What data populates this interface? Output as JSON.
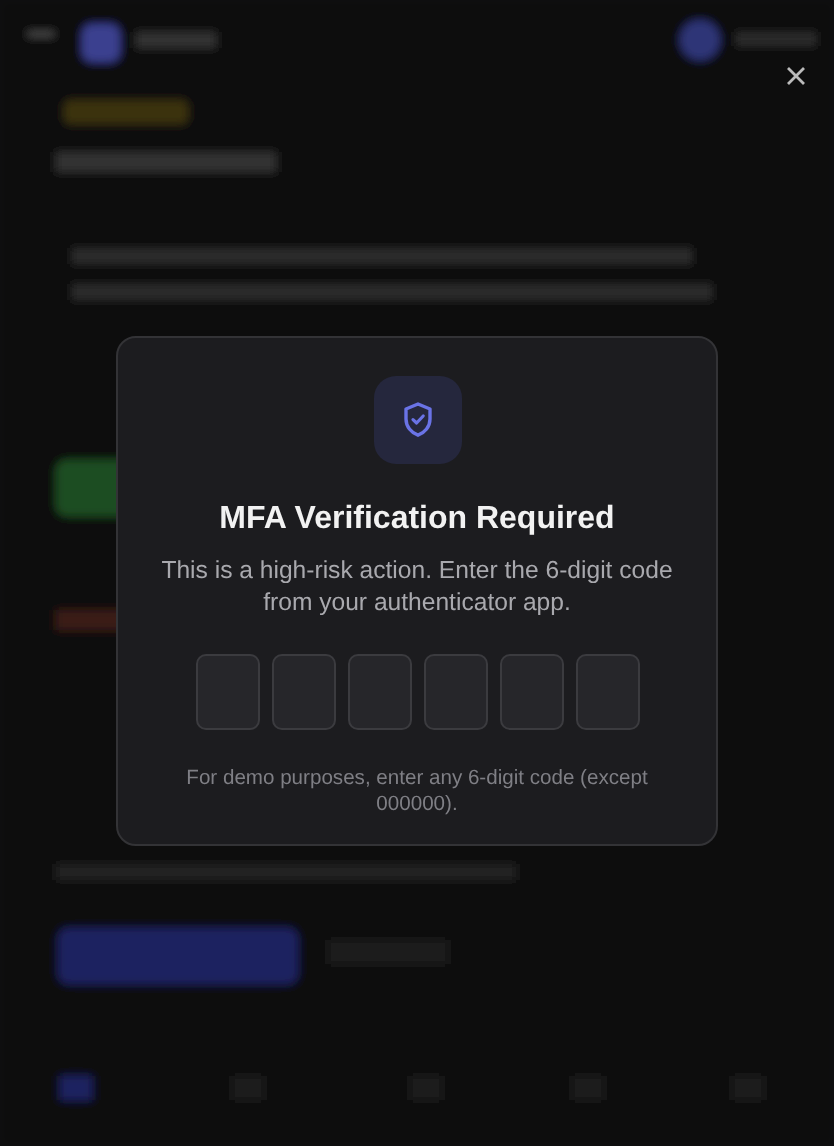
{
  "dialog": {
    "title": "MFA Verification Required",
    "message": "This is a high-risk action. Enter the 6-digit code from your authenticator app.",
    "code_fields": [
      {
        "filled": false
      },
      {
        "filled": false
      },
      {
        "filled": false
      },
      {
        "filled": false
      },
      {
        "filled": false
      },
      {
        "filled": false
      }
    ],
    "hint": "For demo purposes, enter any 6-digit code (except 000000)."
  }
}
